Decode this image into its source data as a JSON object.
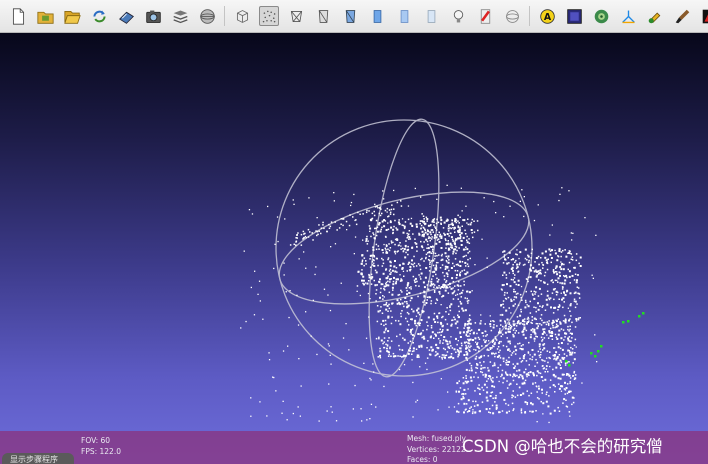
{
  "toolbar": {
    "buttons": [
      {
        "name": "new-project-button",
        "icon": "new-file-icon"
      },
      {
        "name": "open-project-button",
        "icon": "folder-icon"
      },
      {
        "name": "import-mesh-button",
        "icon": "folder-open-icon"
      },
      {
        "name": "reload-button",
        "icon": "reload-icon"
      },
      {
        "name": "export-mesh-button",
        "icon": "export-icon"
      },
      {
        "name": "snapshot-button",
        "icon": "camera-icon"
      },
      {
        "name": "layers-button",
        "icon": "layers-icon"
      },
      {
        "name": "globe-button",
        "icon": "globe-icon"
      },
      {
        "name": "bbox-render-button",
        "icon": "box-icon"
      },
      {
        "name": "points-render-button",
        "icon": "points-icon",
        "active": true
      },
      {
        "name": "wireframe-render-button",
        "icon": "wireframe-icon"
      },
      {
        "name": "hidden-lines-render-button",
        "icon": "hidden-lines-icon"
      },
      {
        "name": "flat-lines-render-button",
        "icon": "flat-lines-icon"
      },
      {
        "name": "flat-render-button",
        "icon": "flat-icon"
      },
      {
        "name": "smooth-render-button",
        "icon": "smooth-icon"
      },
      {
        "name": "texture-render-button",
        "icon": "texture-icon"
      },
      {
        "name": "light-button",
        "icon": "lightbulb-icon"
      },
      {
        "name": "color-mode-button",
        "icon": "color-icon"
      },
      {
        "name": "trackball-button",
        "icon": "trackball-icon"
      },
      {
        "name": "annotation-button",
        "icon": "annotation-a-icon"
      },
      {
        "name": "shader-button",
        "icon": "shader-icon"
      },
      {
        "name": "texture-map-button",
        "icon": "pattern-icon"
      },
      {
        "name": "measure-button",
        "icon": "measure-icon"
      },
      {
        "name": "paint-button",
        "icon": "paint-icon"
      },
      {
        "name": "brush-button",
        "icon": "brush-icon"
      },
      {
        "name": "color-paint-button",
        "icon": "color-paint-icon"
      },
      {
        "name": "select-vertices-button",
        "icon": "select-vertices-icon"
      },
      {
        "name": "select-faces-button",
        "icon": "select-faces-icon"
      }
    ]
  },
  "colors": {
    "viewport_top": "#07071a",
    "viewport_bottom": "#6e6ddb",
    "points": "#ffffff",
    "selected_points": "#22dd22",
    "trackball": "#c8c8d8",
    "infobar": "#8c3078"
  },
  "status": {
    "fov": "FOV: 60",
    "fps": "FPS:   122.0",
    "mesh": "Mesh: fused.ply",
    "vertices": "Vertices: 22122",
    "faces": "Faces: 0",
    "watermark": "CSDN @哈也不会的研究僧",
    "corner_label": "显示步骤程序"
  }
}
